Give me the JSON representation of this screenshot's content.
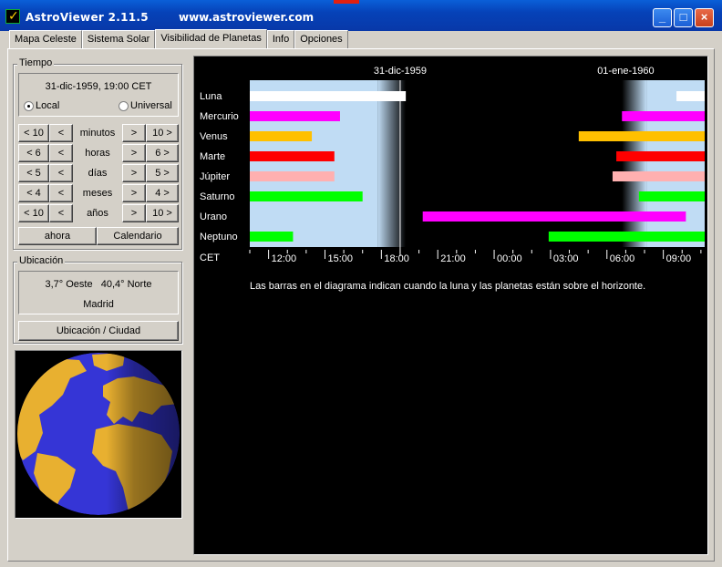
{
  "window": {
    "title": "AstroViewer 2.11.5",
    "url": "www.astroviewer.com",
    "minimize": "_",
    "maximize": "□",
    "close": "×"
  },
  "tabs": [
    "Mapa Celeste",
    "Sistema Solar",
    "Visibilidad de Planetas",
    "Info",
    "Opciones"
  ],
  "active_tab": "Visibilidad de Planetas",
  "tiempo": {
    "title": "Tiempo",
    "datetime": "31-dic-1959, 19:00 CET",
    "local_label": "Local",
    "universal_label": "Universal",
    "selected_mode": "Local",
    "rows": [
      {
        "bb": "< 10",
        "b": "<",
        "label": "minutos",
        "f": ">",
        "ff": "10 >"
      },
      {
        "bb": "< 6",
        "b": "<",
        "label": "horas",
        "f": ">",
        "ff": "6 >"
      },
      {
        "bb": "< 5",
        "b": "<",
        "label": "días",
        "f": ">",
        "ff": "5 >"
      },
      {
        "bb": "< 4",
        "b": "<",
        "label": "meses",
        "f": ">",
        "ff": "4 >"
      },
      {
        "bb": "< 10",
        "b": "<",
        "label": "años",
        "f": ">",
        "ff": "10 >"
      }
    ],
    "now_button": "ahora",
    "calendar_button": "Calendario"
  },
  "ubicacion": {
    "title": "Ubicación",
    "coords": "3,7° Oeste   40,4° Norte",
    "city": "Madrid",
    "button": "Ubicación / Ciudad"
  },
  "chart_data": {
    "type": "gantt",
    "date_labels": [
      {
        "text": "31-dic-1959",
        "hour": 19
      },
      {
        "text": "01-ene-1960",
        "hour": 31
      }
    ],
    "x_range_hours": [
      11.0,
      35.2
    ],
    "axis_label": "CET",
    "ticks": [
      {
        "hour": 12,
        "label": "12:00"
      },
      {
        "hour": 15,
        "label": "15:00"
      },
      {
        "hour": 18,
        "label": "18:00"
      },
      {
        "hour": 21,
        "label": "21:00"
      },
      {
        "hour": 24,
        "label": "00:00"
      },
      {
        "hour": 27,
        "label": "03:00"
      },
      {
        "hour": 30,
        "label": "06:00"
      },
      {
        "hour": 33,
        "label": "09:00"
      }
    ],
    "current_time_hour": 19.0,
    "daylight": [
      {
        "start": 11.0,
        "end": 17.8
      },
      {
        "start": 32.1,
        "end": 35.2
      }
    ],
    "twilight": [
      {
        "start": 17.8,
        "end": 19.3,
        "direction": "dusk"
      },
      {
        "start": 30.8,
        "end": 32.1,
        "direction": "dawn"
      }
    ],
    "series": [
      {
        "name": "Luna",
        "color": "#ffffff",
        "segments": [
          [
            11.0,
            19.3
          ],
          [
            33.7,
            35.2
          ]
        ]
      },
      {
        "name": "Mercurio",
        "color": "#ff00ff",
        "segments": [
          [
            11.0,
            15.8
          ],
          [
            30.8,
            35.2
          ]
        ]
      },
      {
        "name": "Venus",
        "color": "#ffc000",
        "segments": [
          [
            11.0,
            14.3
          ],
          [
            28.5,
            35.2
          ]
        ]
      },
      {
        "name": "Marte",
        "color": "#ff0000",
        "segments": [
          [
            11.0,
            15.5
          ],
          [
            30.5,
            35.2
          ]
        ]
      },
      {
        "name": "Júpiter",
        "color": "#ffb0b0",
        "segments": [
          [
            11.0,
            15.5
          ],
          [
            30.3,
            35.2
          ]
        ]
      },
      {
        "name": "Saturno",
        "color": "#00ff00",
        "segments": [
          [
            11.0,
            17.0
          ],
          [
            31.7,
            35.2
          ]
        ]
      },
      {
        "name": "Urano",
        "color": "#ff00ff",
        "segments": [
          [
            20.2,
            34.2
          ]
        ]
      },
      {
        "name": "Neptuno",
        "color": "#00ff00",
        "segments": [
          [
            11.0,
            13.3
          ],
          [
            26.9,
            35.2
          ]
        ]
      }
    ],
    "caption": "Las barras en el diagrama indican cuando la luna y las planetas están sobre el horizonte."
  }
}
